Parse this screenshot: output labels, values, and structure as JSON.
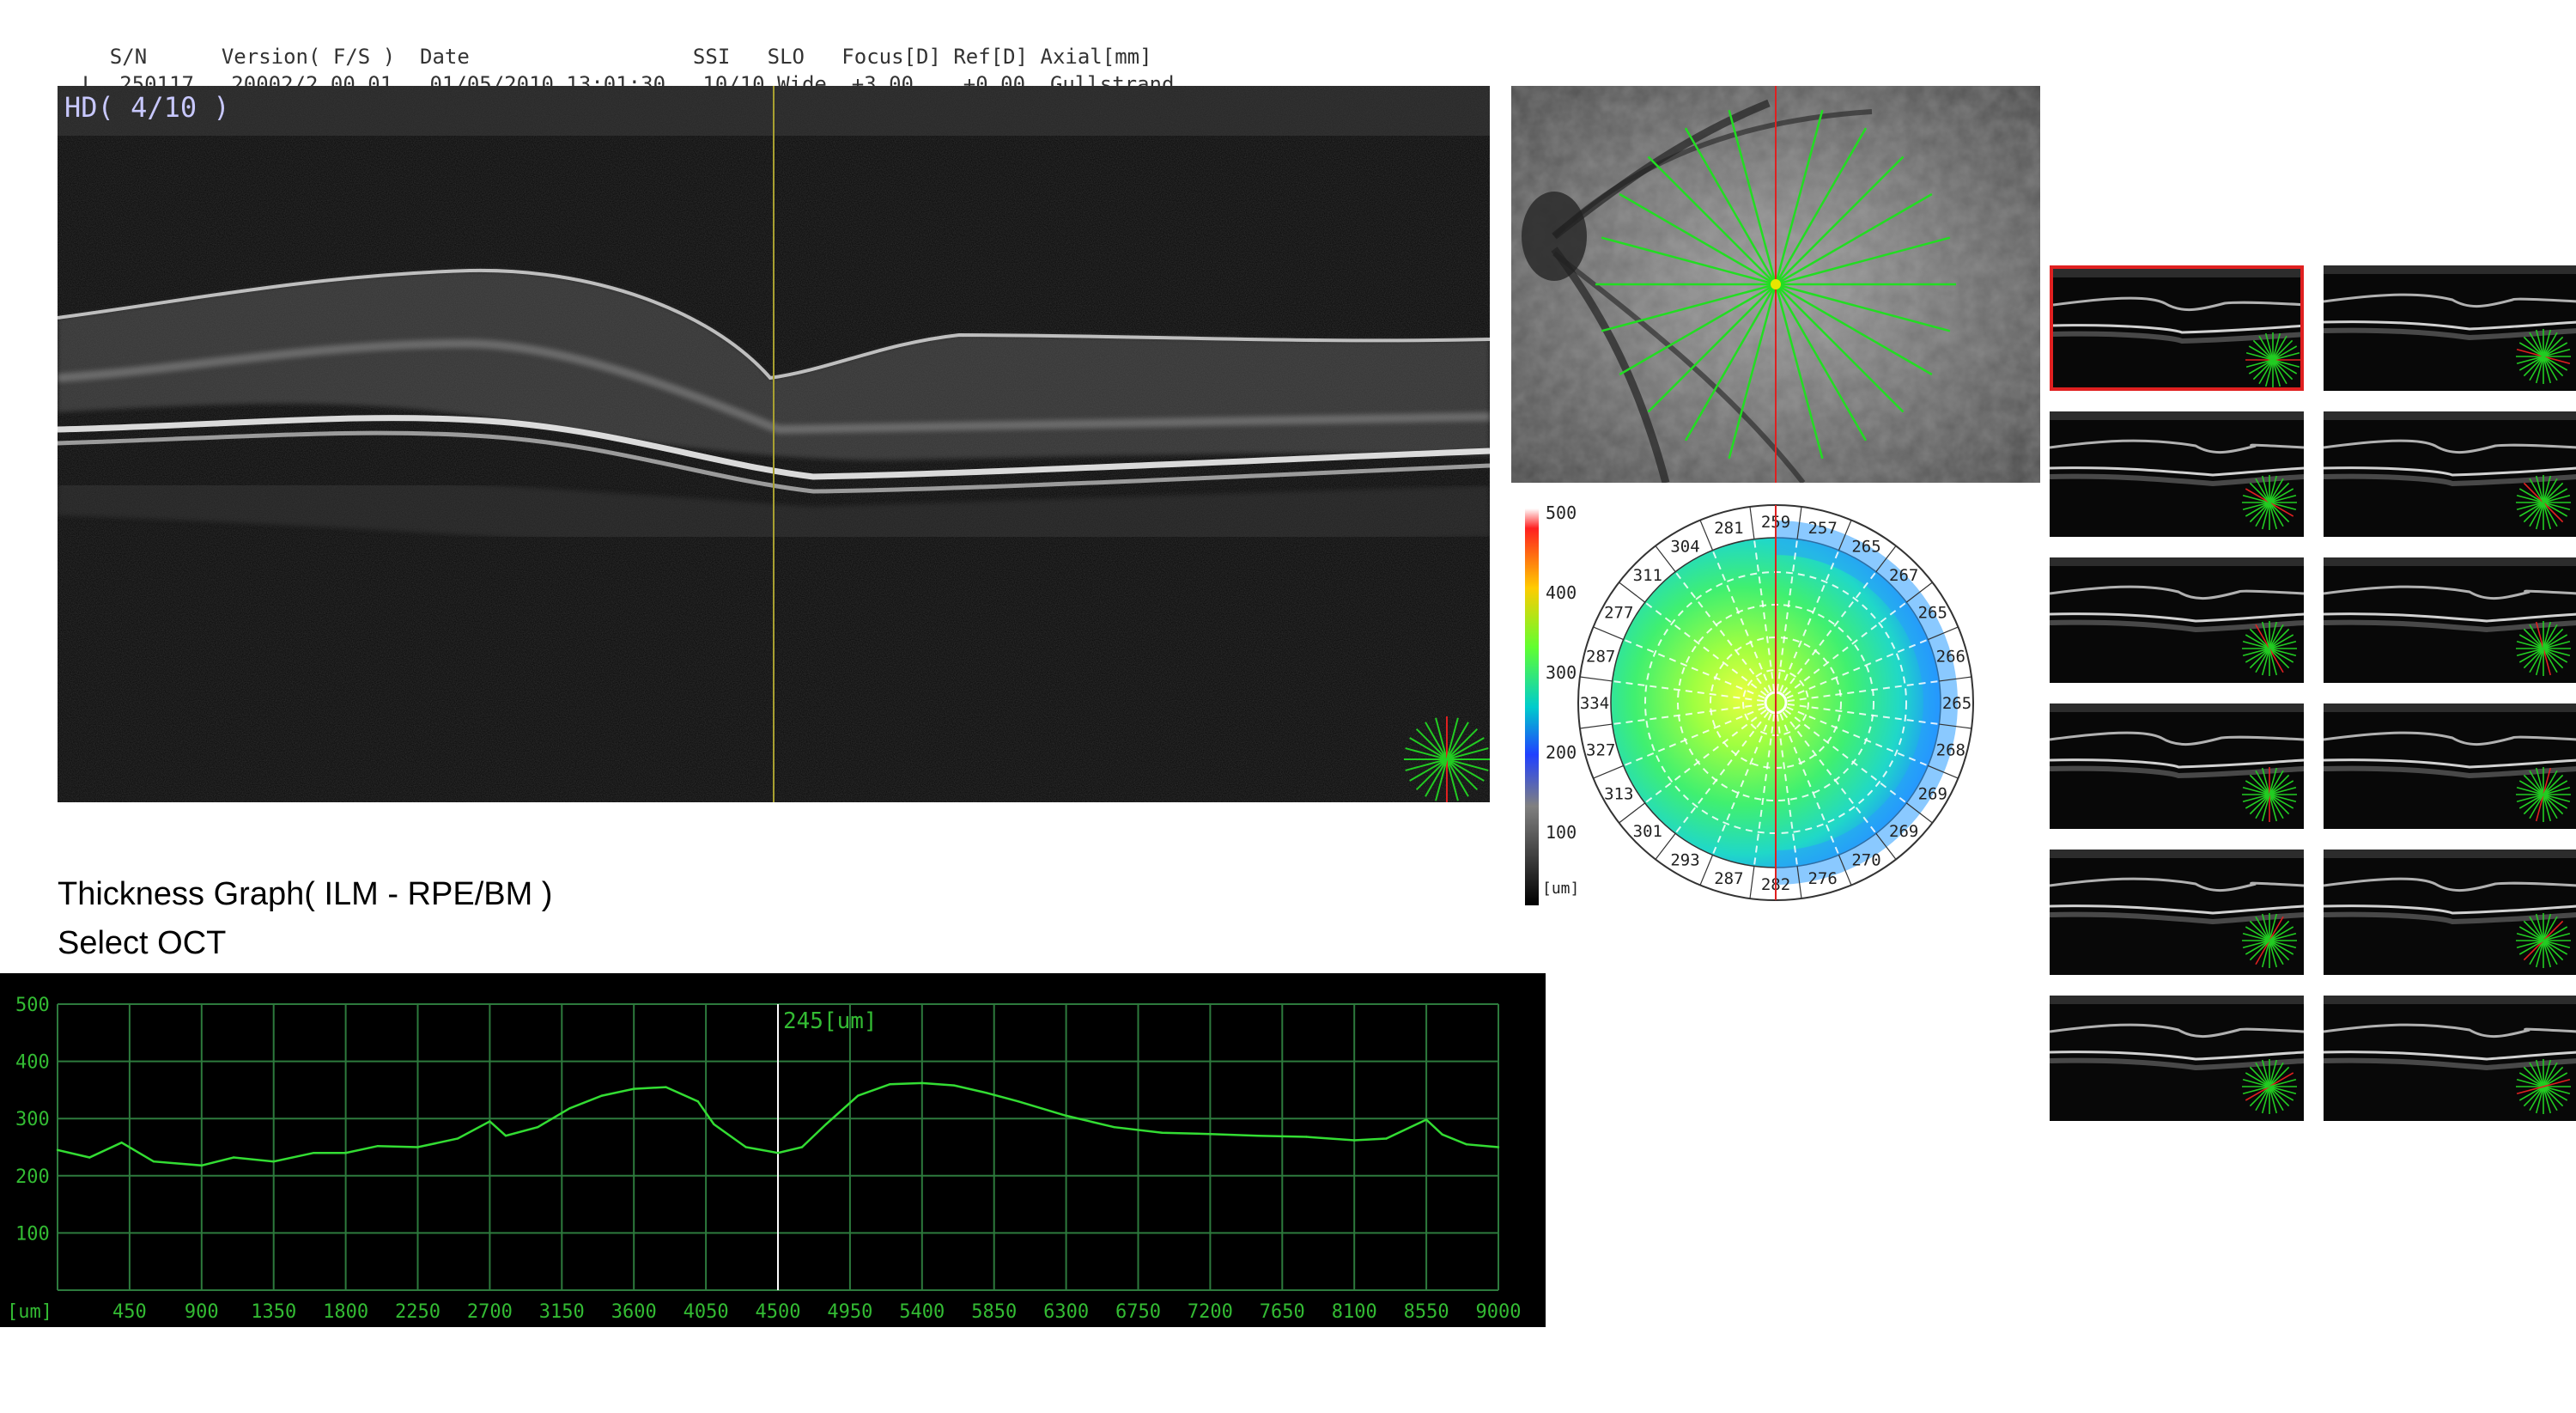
{
  "header": {
    "eye": "L",
    "columns": [
      {
        "label": "S/N",
        "value": "250117"
      },
      {
        "label": "Version( F/S )",
        "value": "20002/2.00.01"
      },
      {
        "label": "Date",
        "value": "01/05/2010 13:01:30"
      },
      {
        "label": "SSI",
        "value": "10/10"
      },
      {
        "label": "SLO",
        "value": "Wide"
      },
      {
        "label": "Focus[D]",
        "value": "+3.00"
      },
      {
        "label": "Ref[D]",
        "value": "+0.00"
      },
      {
        "label": "Axial[mm]",
        "value": "Gullstrand"
      }
    ]
  },
  "oct_view": {
    "scan_label": "HD( 4/10 )"
  },
  "thickness_map": {
    "scale_ticks": [
      "500",
      "400",
      "300",
      "200",
      "100"
    ],
    "unit": "[um]",
    "outer_ring_values": [
      "259",
      "257",
      "265",
      "267",
      "265",
      "266",
      "265",
      "268",
      "269",
      "269",
      "270",
      "276",
      "282",
      "287",
      "293",
      "301",
      "313",
      "327",
      "334",
      "287",
      "277",
      "311",
      "304",
      "281"
    ]
  },
  "titles": {
    "thickness_graph": "Thickness Graph( ILM - RPE/BM )",
    "select_oct": "Select OCT"
  },
  "chart_data": {
    "type": "line",
    "title": "Thickness Graph( ILM - RPE/BM )",
    "xlabel": "[um]",
    "ylabel": "",
    "xlim": [
      0,
      9000
    ],
    "ylim": [
      0,
      500
    ],
    "x_ticks": [
      "450",
      "900",
      "1350",
      "1800",
      "2250",
      "2700",
      "3150",
      "3600",
      "4050",
      "4500",
      "4950",
      "5400",
      "5850",
      "6300",
      "6750",
      "7200",
      "7650",
      "8100",
      "8550",
      "9000"
    ],
    "y_ticks": [
      "500",
      "400",
      "300",
      "200",
      "100"
    ],
    "cursor": {
      "x": 4500,
      "label": "245[um]"
    },
    "series": [
      {
        "color": "#33dd33",
        "x": [
          0,
          200,
          400,
          600,
          900,
          1100,
          1350,
          1600,
          1800,
          2000,
          2250,
          2500,
          2700,
          2800,
          3000,
          3200,
          3400,
          3600,
          3800,
          4000,
          4100,
          4300,
          4500,
          4650,
          4800,
          5000,
          5200,
          5400,
          5600,
          5800,
          6000,
          6300,
          6600,
          6900,
          7200,
          7500,
          7800,
          8100,
          8300,
          8550,
          8650,
          8800,
          9000
        ],
        "y": [
          245,
          232,
          258,
          225,
          218,
          232,
          225,
          240,
          240,
          252,
          250,
          265,
          295,
          270,
          285,
          318,
          340,
          352,
          355,
          330,
          290,
          250,
          240,
          250,
          290,
          340,
          360,
          362,
          358,
          345,
          330,
          305,
          285,
          275,
          273,
          270,
          268,
          262,
          265,
          298,
          272,
          255,
          250
        ]
      }
    ]
  },
  "thumbnails": {
    "count": 12,
    "selected_index": 0
  },
  "colors": {
    "graph_line": "#33dd33",
    "grid": "#2d7a3d",
    "axis_text": "#33bb33",
    "selected_border": "#e02020",
    "scan_line": "#22cc22",
    "scan_selected": "#e02020",
    "slice_marker": "#a8a030"
  }
}
